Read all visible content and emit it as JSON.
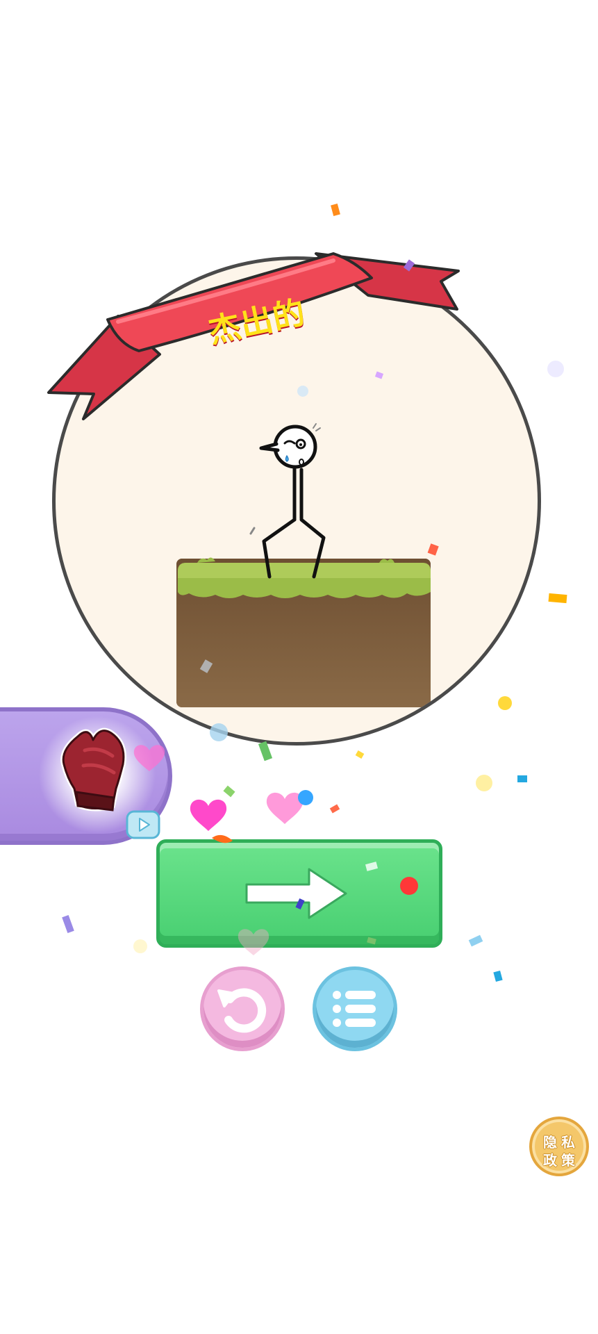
{
  "result": {
    "ribbon_text": "杰出的"
  },
  "reward": {
    "item_icon": "red-glove-icon",
    "ad_icon": "video-play-icon"
  },
  "actions": {
    "next_icon": "arrow-right-icon",
    "restart_icon": "restart-icon",
    "menu_icon": "menu-list-icon"
  },
  "privacy": {
    "line1": "隐私",
    "line2": "政策"
  },
  "colors": {
    "ribbon": "#e8404f",
    "next_button": "#4fd377",
    "restart_button": "#f4b9e0",
    "menu_button": "#8fd8f1",
    "reward_pill": "#b79be8",
    "privacy_badge": "#f4c76a"
  }
}
